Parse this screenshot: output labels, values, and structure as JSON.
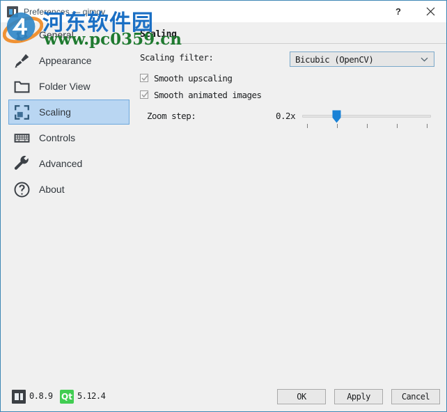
{
  "window": {
    "title": "Preferences — qimgv",
    "app_icon": "qimgv-app-icon",
    "help_label": "?",
    "close_label": "✕",
    "border_color": "#3d87b5"
  },
  "watermark": {
    "site_name": "河东软件园",
    "url": "www.pc0359.cn",
    "logo": "circle-logo-icon"
  },
  "sidebar": {
    "items": [
      {
        "label": "General",
        "icon": "gear-icon",
        "selected": false
      },
      {
        "label": "Appearance",
        "icon": "brush-icon",
        "selected": false
      },
      {
        "label": "Folder View",
        "icon": "folder-icon",
        "selected": false
      },
      {
        "label": "Scaling",
        "icon": "scaling-icon",
        "selected": true
      },
      {
        "label": "Controls",
        "icon": "keyboard-icon",
        "selected": false
      },
      {
        "label": "Advanced",
        "icon": "wrench-icon",
        "selected": false
      },
      {
        "label": "About",
        "icon": "question-circle-icon",
        "selected": false
      }
    ],
    "selected_bg": "#b9d6f2",
    "selected_border": "#6ba7dc"
  },
  "content": {
    "heading": "Scaling",
    "scaling_filter": {
      "label": "Scaling filter:",
      "value": "Bicubic (OpenCV)",
      "arrow_icon": "chevron-down-icon"
    },
    "smooth_upscaling": {
      "label": "Smooth upscaling",
      "checked": true
    },
    "smooth_animated": {
      "label": "Smooth animated images",
      "checked": true
    },
    "zoom_step": {
      "label": "Zoom step:",
      "value": "0.2x",
      "slider_percent": 25,
      "tick_count": 5
    }
  },
  "statusbar": {
    "app_icon": "qimgv-logo-icon",
    "app_version": "0.8.9",
    "qt_badge": "Qt",
    "qt_badge_color": "#41cd52",
    "qt_version": "5.12.4"
  },
  "buttons": {
    "ok": "OK",
    "apply": "Apply",
    "cancel": "Cancel"
  }
}
